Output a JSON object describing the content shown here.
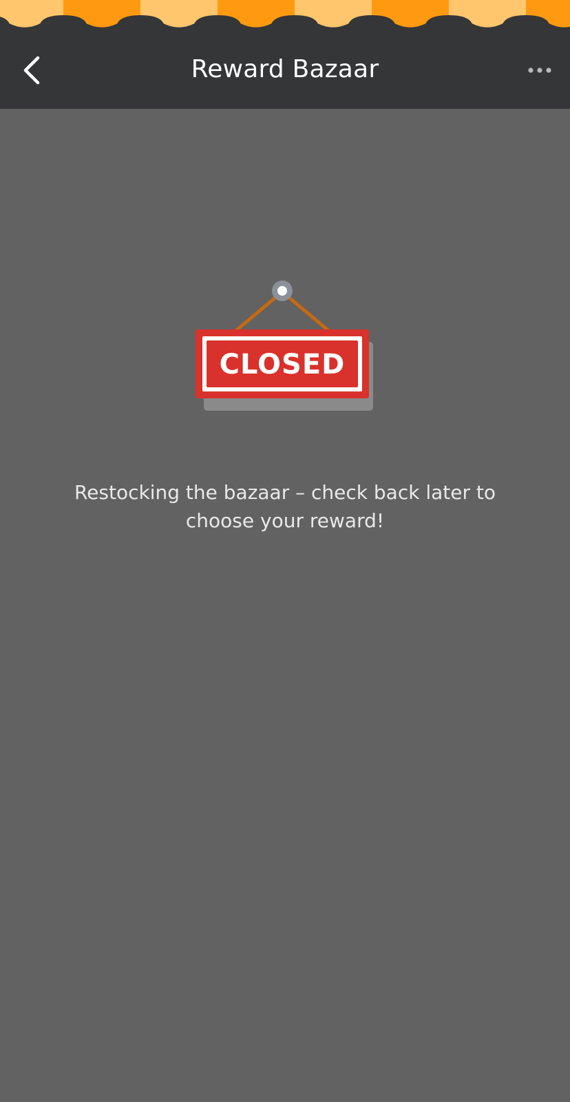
{
  "header": {
    "title": "Reward Bazaar",
    "back_icon": "chevron-left-icon",
    "more_icon": "more-horizontal-icon"
  },
  "awning": {
    "stripe_colors": [
      "#FFC66E",
      "#FF9A10"
    ]
  },
  "closed_sign": {
    "label": "CLOSED",
    "sign_color": "#D9312B",
    "string_color": "#C56A12",
    "pin_color": "#8B9099"
  },
  "empty_state": {
    "message": "Restocking the bazaar – check back later to choose your reward!"
  },
  "colors": {
    "topbar": "#353638",
    "background": "#626262",
    "text": "#E9E9E9"
  }
}
